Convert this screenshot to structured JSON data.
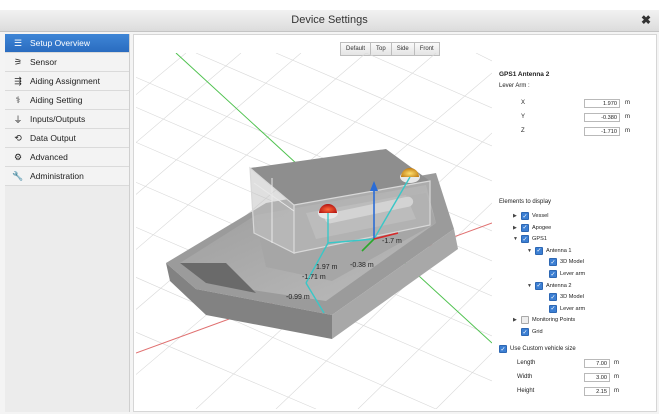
{
  "window": {
    "title": "Device Settings",
    "close_glyph": "✖"
  },
  "sidebar": {
    "items": [
      {
        "label": "Setup Overview",
        "icon": "list-icon",
        "glyph": "☰",
        "active": true
      },
      {
        "label": "Sensor",
        "icon": "sensor-icon",
        "glyph": "⚞",
        "active": false
      },
      {
        "label": "Aiding Assignment",
        "icon": "assignment-icon",
        "glyph": "⇶",
        "active": false
      },
      {
        "label": "Aiding Setting",
        "icon": "aiding-setting-icon",
        "glyph": "⚕",
        "active": false
      },
      {
        "label": "Inputs/Outputs",
        "icon": "plug-icon",
        "glyph": "⏚",
        "active": false
      },
      {
        "label": "Data Output",
        "icon": "data-output-icon",
        "glyph": "⟲",
        "active": false
      },
      {
        "label": "Advanced",
        "icon": "gear-icon",
        "glyph": "⚙",
        "active": false
      },
      {
        "label": "Administration",
        "icon": "wrench-icon",
        "glyph": "🔧",
        "active": false
      }
    ]
  },
  "view_buttons": [
    "Default",
    "Top",
    "Side",
    "Front"
  ],
  "viewport": {
    "labels": [
      "-1.7 m",
      "1.97 m",
      "-0.38 m",
      "-1.71 m",
      "-0.99 m"
    ]
  },
  "props": {
    "title": "GPS1 Antenna 2",
    "lever_arm_label": "Lever Arm :",
    "lever_arm": [
      {
        "axis": "X",
        "value": "1.970",
        "unit": "m"
      },
      {
        "axis": "Y",
        "value": "-0.380",
        "unit": "m"
      },
      {
        "axis": "Z",
        "value": "-1.710",
        "unit": "m"
      }
    ],
    "elements_label": "Elements to display",
    "tree": [
      {
        "label": "Vessel",
        "arrow": "▶",
        "state": "on",
        "indent": 0
      },
      {
        "label": "Apogee",
        "arrow": "▶",
        "state": "on",
        "indent": 0
      },
      {
        "label": "GPS1",
        "arrow": "▼",
        "state": "on",
        "indent": 0
      },
      {
        "label": "Antenna 1",
        "arrow": "▼",
        "state": "on",
        "indent": 1
      },
      {
        "label": "3D Model",
        "arrow": "",
        "state": "on",
        "indent": 2
      },
      {
        "label": "Lever arm",
        "arrow": "",
        "state": "on",
        "indent": 2
      },
      {
        "label": "Antenna 2",
        "arrow": "▼",
        "state": "on",
        "indent": 1
      },
      {
        "label": "3D Model",
        "arrow": "",
        "state": "on",
        "indent": 2
      },
      {
        "label": "Lever arm",
        "arrow": "",
        "state": "on",
        "indent": 2
      },
      {
        "label": "Monitoring Points",
        "arrow": "▶",
        "state": "off",
        "indent": 0
      },
      {
        "label": "Grid",
        "arrow": "",
        "state": "on",
        "indent": 0
      }
    ],
    "custom_size_label": "Use Custom vehicle size",
    "size": [
      {
        "label": "Length",
        "value": "7.00",
        "unit": "m"
      },
      {
        "label": "Width",
        "value": "3.00",
        "unit": "m"
      },
      {
        "label": "Height",
        "value": "2.15",
        "unit": "m"
      }
    ]
  }
}
